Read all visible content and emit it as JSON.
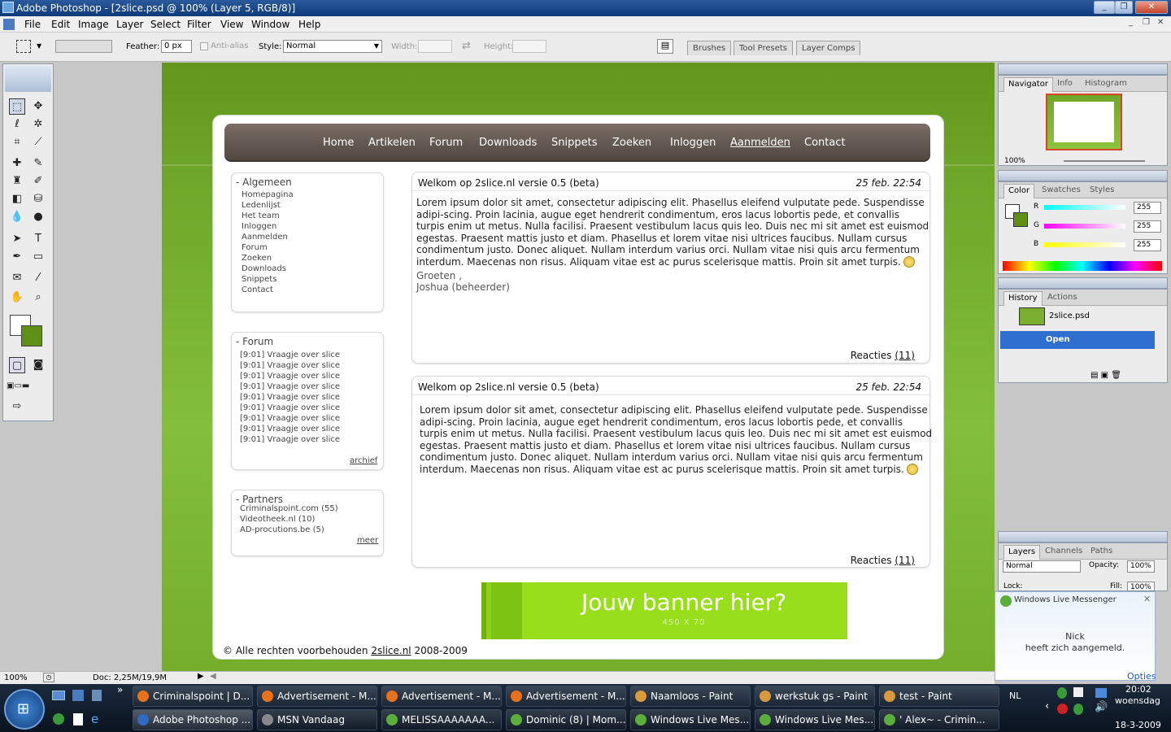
{
  "window": {
    "title": "Adobe Photoshop - [2slice.psd @ 100% (Layer 5, RGB/8)]"
  },
  "menu": [
    "File",
    "Edit",
    "Image",
    "Layer",
    "Select",
    "Filter",
    "View",
    "Window",
    "Help"
  ],
  "options": {
    "feather_label": "Feather:",
    "feather_value": "0 px",
    "antialias_label": "Anti-alias",
    "style_label": "Style:",
    "style_value": "Normal",
    "width_label": "Width:",
    "height_label": "Height:"
  },
  "palette_well": [
    "Brushes",
    "Tool Presets",
    "Layer Comps"
  ],
  "site": {
    "nav": [
      "Home",
      "Artikelen",
      "Forum",
      "Downloads",
      "Snippets",
      "Zoeken",
      "Inloggen",
      "Aanmelden",
      "Contact"
    ],
    "algemeen": {
      "title": "- Algemeen",
      "items": [
        "Homepagina",
        "Ledenlijst",
        "Het team",
        "Inloggen",
        "Aanmelden",
        "Forum",
        "Zoeken",
        "Downloads",
        "Snippets",
        "Contact"
      ]
    },
    "forum": {
      "title": "- Forum",
      "items": [
        "[9:01] Vraagje over slice",
        "[9:01] Vraagje over slice",
        "[9:01] Vraagje over slice",
        "[9:01] Vraagje over slice",
        "[9:01] Vraagje over slice",
        "[9:01] Vraagje over slice",
        "[9:01] Vraagje over slice",
        "[9:01] Vraagje over slice",
        "[9:01] Vraagje over slice"
      ],
      "more": "archief"
    },
    "partners": {
      "title": "- Partners",
      "items": [
        "Criminalspoint.com (55)",
        "Videotheek.nl (10)",
        "AD-procutions.be (5)"
      ],
      "more": "meer"
    },
    "posts": [
      {
        "title": "Welkom op 2slice.nl versie 0.5 (beta)",
        "date": "25 feb.  22:54",
        "body": "Lorem ipsum dolor sit amet, consectetur adipiscing elit. Phasellus eleifend vulputate pede. Suspendisse adipi-scing. Proin lacinia, augue eget hendrerit condimentum, eros lacus lobortis pede, et convallis turpis enim ut metus. Nulla facilisi. Praesent vestibulum lacus quis leo. Duis nec mi sit amet est euismod egestas. Praesent mattis justo et diam. Phasellus et lorem vitae nisi ultrices faucibus. Nullam cursus condimentum justo. Donec aliquet. Nullam interdum varius orci. Nullam vitae nisi quis arcu fermentum interdum. Maecenas non risus. Aliquam vitae est ac purus scelerisque mattis. Proin sit amet turpis.",
        "sig1": "Groeten ,",
        "sig2": "Joshua (beheerder)",
        "reacties": "Reacties",
        "count": "(11)"
      },
      {
        "title": "Welkom op 2slice.nl versie 0.5 (beta)",
        "date": "25 feb.  22:54",
        "body": "Lorem ipsum dolor sit amet, consectetur adipiscing elit. Phasellus eleifend vulputate pede. Suspendisse adipi-scing. Proin lacinia, augue eget hendrerit condimentum, eros lacus lobortis pede, et convallis turpis enim ut metus. Nulla facilisi. Praesent vestibulum lacus quis leo. Duis nec mi sit amet est euismod egestas. Praesent mattis justo et diam. Phasellus et lorem vitae nisi ultrices faucibus. Nullam cursus condimentum justo. Donec aliquet. Nullam interdum varius orci. Nullam vitae nisi quis arcu fermentum interdum. Maecenas non risus. Aliquam vitae est ac purus scelerisque mattis. Proin sit amet turpis.",
        "reacties": "Reacties",
        "count": "(11)"
      }
    ],
    "banner": {
      "title": "Jouw banner hier?",
      "size": "450 X 70"
    },
    "footer": {
      "pre": "© Alle rechten voorbehouden ",
      "link": "2slice.nl",
      "post": " 2008-2009"
    }
  },
  "status": {
    "zoom": "100%",
    "doc": "Doc: 2,25M/19,9M"
  },
  "panels": {
    "navigator": {
      "tabs": [
        "Navigator",
        "Info",
        "Histogram"
      ],
      "zoom": "100%"
    },
    "color": {
      "tabs": [
        "Color",
        "Swatches",
        "Styles"
      ],
      "r_label": "R",
      "g_label": "G",
      "b_label": "B",
      "r": "255",
      "g": "255",
      "b": "255"
    },
    "history": {
      "tabs": [
        "History",
        "Actions"
      ],
      "snapshot": "2slice.psd",
      "state": "Open"
    },
    "layers": {
      "tabs": [
        "Layers",
        "Channels",
        "Paths"
      ],
      "mode": "Normal",
      "opacity_label": "Opacity:",
      "opacity": "100%",
      "lock_label": "Lock:",
      "fill_label": "Fill:",
      "fill": "100%"
    }
  },
  "messenger": {
    "title": "Windows Live Messenger",
    "name": "Nick",
    "message": "heeft zich aangemeld.",
    "options": "Opties"
  },
  "taskbar": {
    "row1": [
      "Criminalspoint | D...",
      "Advertisement - M...",
      "Advertisement - M...",
      "Advertisement - M...",
      "Naamloos - Paint",
      "werkstuk gs - Paint",
      "test - Paint"
    ],
    "row2": [
      "Adobe Photoshop ...",
      "MSN Vandaag",
      "MELISSAAAAAAA...",
      "Dominic (8) | Mom...",
      "Windows Live Mes...",
      "Windows Live Mes...",
      "' Alex~ - Crimin..."
    ],
    "lang": "NL",
    "time": "20:02",
    "day": "woensdag",
    "date": "18-3-2009"
  }
}
